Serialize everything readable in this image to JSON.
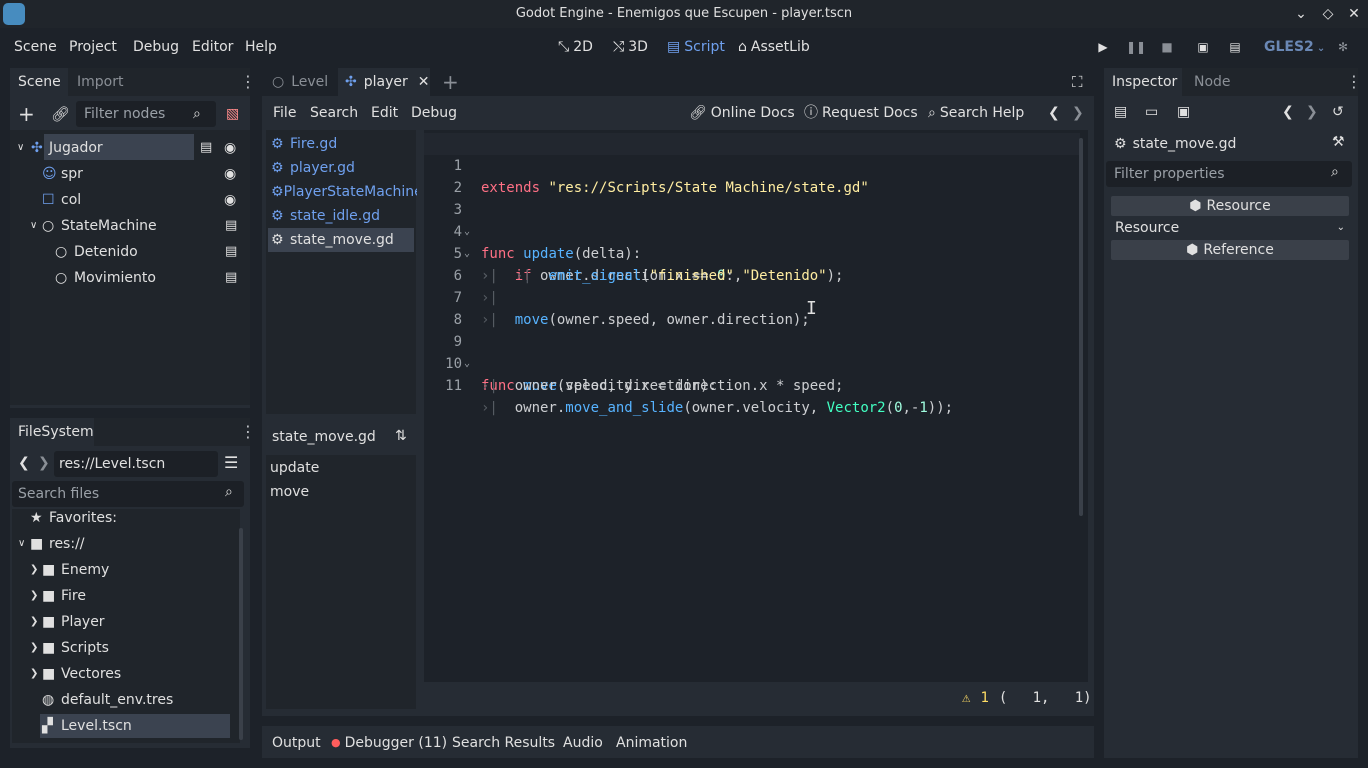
{
  "window": {
    "title": "Godot Engine - Enemigos que Escupen - player.tscn"
  },
  "menu": [
    "Scene",
    "Project",
    "Debug",
    "Editor",
    "Help"
  ],
  "workspaces": {
    "w2d": "2D",
    "w3d": "3D",
    "script": "Script",
    "assetlib": "AssetLib",
    "active": "Script"
  },
  "renderer": "GLES2",
  "colors": {
    "bg": "#1d2229",
    "panel": "#262c34",
    "accent": "#6fa0ee",
    "selection": "#3b4350",
    "warning": "#ffdd65",
    "debug_dot": "#ff5d5d"
  },
  "scene_dock": {
    "tabs": [
      "Scene",
      "Import"
    ],
    "filter_placeholder": "Filter nodes",
    "tree": [
      {
        "name": "Jugador",
        "icon": "kinematic-body-icon"
      },
      {
        "name": "spr",
        "icon": "sprite-icon"
      },
      {
        "name": "col",
        "icon": "collision-shape-icon"
      },
      {
        "name": "StateMachine",
        "icon": "node-icon"
      },
      {
        "name": "Detenido",
        "icon": "node-icon"
      },
      {
        "name": "Movimiento",
        "icon": "node-icon"
      }
    ]
  },
  "filesystem": {
    "title": "FileSystem",
    "path": "res://Level.tscn",
    "search_placeholder": "Search files",
    "favorites": "Favorites:",
    "root": "res://",
    "folders": [
      "Enemy",
      "Fire",
      "Player",
      "Scripts",
      "Vectores"
    ],
    "files": [
      "default_env.tres",
      "Level.tscn"
    ]
  },
  "editor_tabs": [
    {
      "label": "Level"
    },
    {
      "label": "player"
    }
  ],
  "script_menu": [
    "File",
    "Search",
    "Edit",
    "Debug"
  ],
  "script_help": {
    "online_docs": "Online Docs",
    "request_docs": "Request Docs",
    "search_help": "Search Help"
  },
  "script_list": [
    "Fire.gd",
    "player.gd",
    "PlayerStateMachine",
    "state_idle.gd",
    "state_move.gd"
  ],
  "method_panel": {
    "file": "state_move.gd",
    "methods": [
      "update",
      "move"
    ]
  },
  "code": {
    "l1": {
      "n": "1",
      "extends": "extends",
      "path": "\"res://Scripts/State Machine/state.gd\""
    },
    "l2": {
      "n": "2"
    },
    "l3": {
      "n": "3",
      "func": "func",
      "name": "update",
      "args": "(delta):"
    },
    "l4": {
      "n": "4",
      "if": "if",
      "rest": " owner.direction.x == ",
      "zero": "0",
      "colon": ":"
    },
    "l5": {
      "n": "5",
      "call": "emit_signal",
      "open": "(",
      "s1": "\"finished\"",
      "comma": ",",
      "s2": "\"Detenido\"",
      "close": ");"
    },
    "l6": {
      "n": "6"
    },
    "l7": {
      "n": "7",
      "call": "move",
      "args": "(owner.speed, owner.direction);"
    },
    "l8": {
      "n": "8"
    },
    "l9": {
      "n": "9",
      "func": "func",
      "name": "move",
      "args": "(speed, direction):"
    },
    "l10": {
      "n": "10",
      "text": "owner.velocity.x = direction.x * speed;"
    },
    "l11": {
      "n": "11",
      "a": "owner.",
      "call": "move_and_slide",
      "b": "(owner.velocity, ",
      "type": "Vector2",
      "c": "(",
      "n0": "0",
      "d": ",-",
      "n1": "1",
      "e": "));"
    }
  },
  "status": {
    "warnings": "1",
    "cursor": "(   1,   1)"
  },
  "bottom_tabs": [
    "Output",
    "Debugger (11)",
    "Search Results",
    "Audio",
    "Animation"
  ],
  "inspector": {
    "tabs": [
      "Inspector",
      "Node"
    ],
    "object": "state_move.gd",
    "filter_placeholder": "Filter properties",
    "section": "Resource",
    "category": "Resource",
    "subsection": "Reference"
  }
}
